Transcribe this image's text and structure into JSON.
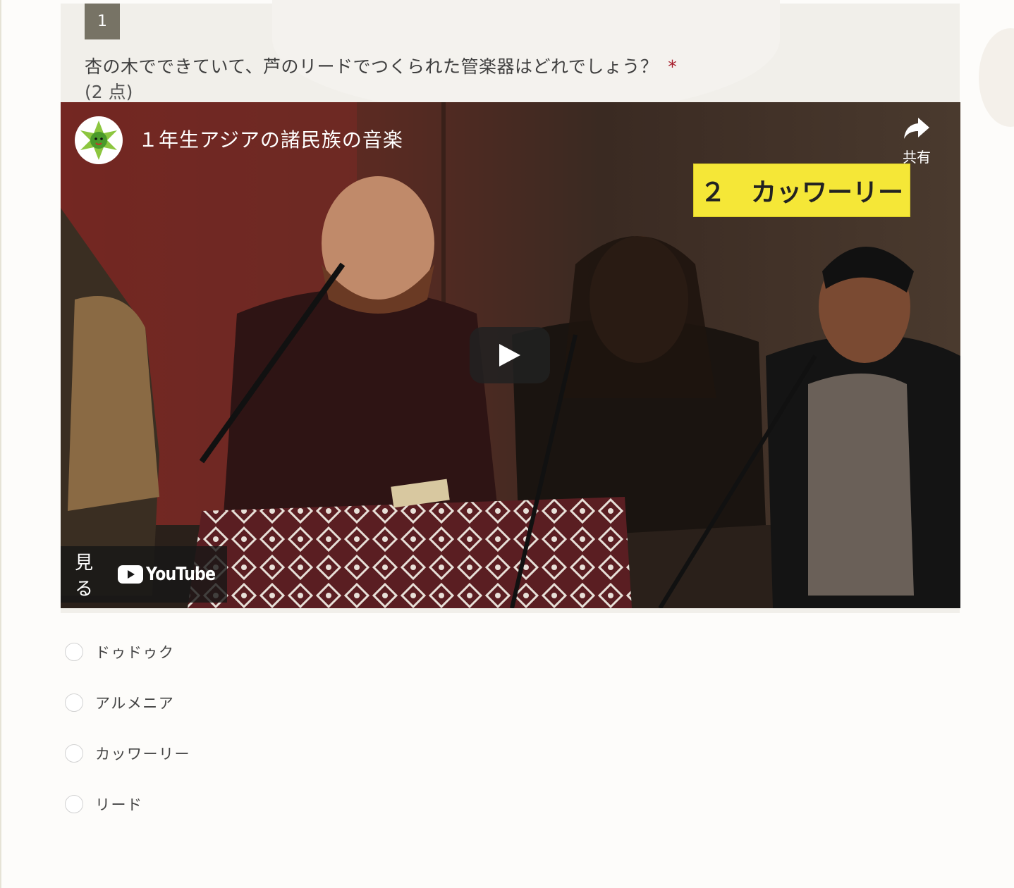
{
  "question": {
    "number": "1",
    "text": "杏の木でできていて、芦のリードでつくられた管楽器はどれでしょう？",
    "required_mark": "*",
    "points": "(2 点)"
  },
  "video": {
    "title": "１年生アジアの諸民族の音楽",
    "share_label": "共有",
    "banner": "２　カッワーリー",
    "watch_label": "見る",
    "platform": "YouTube"
  },
  "options": [
    {
      "label": "ドゥドゥク"
    },
    {
      "label": "アルメニア"
    },
    {
      "label": "カッワーリー"
    },
    {
      "label": "リード"
    }
  ],
  "colors": {
    "question_number_bg": "#777365",
    "required": "#a61c2a",
    "banner_bg": "#f5e737",
    "youtube_red": "#ff0000"
  }
}
